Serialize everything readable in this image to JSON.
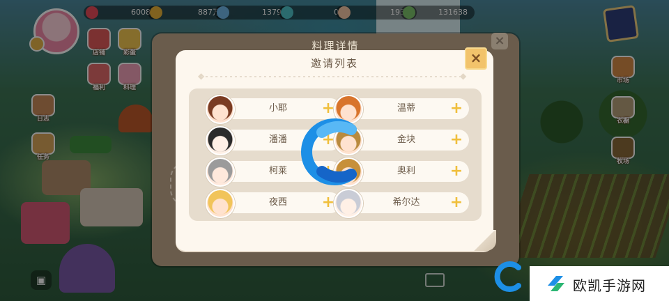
{
  "hud": {
    "resources": [
      {
        "icon": "heart-icon",
        "value": "6008",
        "color": "#e94b5a"
      },
      {
        "icon": "coin-icon",
        "value": "887万",
        "color": "#e9b33a"
      },
      {
        "icon": "crystal-icon",
        "value": "1379",
        "color": "#6fb7e8"
      },
      {
        "icon": "clock-icon",
        "value": "0",
        "color": "#4fc3c9"
      },
      {
        "icon": "pig-icon",
        "value": "1930",
        "color": "#f5c6a6"
      },
      {
        "icon": "leaf-icon",
        "value": "131638",
        "color": "#7cc36b"
      }
    ],
    "side_buttons": [
      {
        "name": "shop-button",
        "label": "店铺",
        "color": "#e15a5a"
      },
      {
        "name": "egg-button",
        "label": "彩蛋",
        "color": "#f3c650"
      },
      {
        "name": "welfare-button",
        "label": "福利",
        "color": "#e26a6a"
      },
      {
        "name": "recipe-button",
        "label": "料理",
        "color": "#f1a0b8"
      },
      {
        "name": "log-button",
        "label": "日志",
        "color": "#c98a5a"
      },
      {
        "name": "task-button",
        "label": "任务",
        "color": "#d9a65a"
      },
      {
        "name": "market-button",
        "label": "市场",
        "color": "#d68b45"
      },
      {
        "name": "wardrobe-button",
        "label": "衣橱",
        "color": "#b7a07a"
      },
      {
        "name": "ranch-button",
        "label": "牧场",
        "color": "#8a6a3a"
      }
    ]
  },
  "back_panel": {
    "title": "料理详情",
    "close_label": "×"
  },
  "dialog": {
    "title": "邀请列表",
    "close_label": "×",
    "add_label": "+",
    "friends": [
      {
        "name": "小耶",
        "hair": "#7a3b22",
        "skin": "#ffe2cf"
      },
      {
        "name": "温蒂",
        "hair": "#d8742c",
        "skin": "#ffe2cf"
      },
      {
        "name": "潘潘",
        "hair": "#2b2b2b",
        "skin": "#fff0e6"
      },
      {
        "name": "金块",
        "hair": "#b98a3e",
        "skin": "#ffe2cf"
      },
      {
        "name": "柯莱",
        "hair": "#9b9b9b",
        "skin": "#ffe9dc"
      },
      {
        "name": "奥利",
        "hair": "#c7903a",
        "skin": "#ffe2cf"
      },
      {
        "name": "夜西",
        "hair": "#f1c45a",
        "skin": "#ffe2cf"
      },
      {
        "name": "希尔达",
        "hair": "#c9ccd6",
        "skin": "#fff0e6"
      }
    ]
  },
  "watermark": {
    "text": "欧凯手游网",
    "accent": "#1f8ae6"
  }
}
